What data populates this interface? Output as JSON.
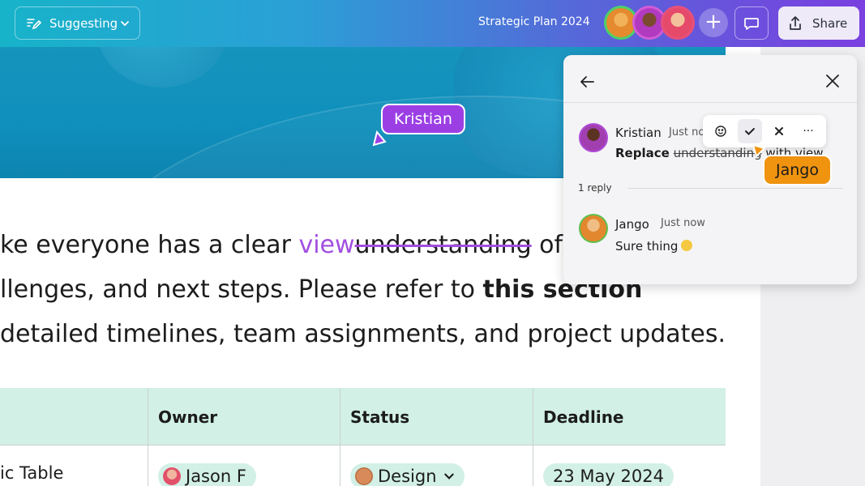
{
  "header": {
    "mode_label": "Suggesting",
    "doc_title": "Strategic Plan 2024",
    "share_label": "Share",
    "add_user_glyph": "+"
  },
  "canvas": {
    "cursor_label": "Kristian",
    "paragraph": {
      "line1_start": "ke everyone has a clear ",
      "line1_inserted": "view",
      "line1_deleted": "understanding",
      "line1_end": " of th",
      "line2_start": "llenges, and next steps. Please refer to ",
      "line2_bold": "this section",
      "line3": "detailed timelines, team assignments, and project updates."
    },
    "table": {
      "headers": [
        "",
        "Owner",
        "Status",
        "Deadline"
      ],
      "row1": {
        "c1": "ic Table",
        "owner": "Jason F",
        "status": "Design",
        "deadline": "23 May 2024"
      }
    }
  },
  "comments": {
    "thread": {
      "author": "Kristian",
      "time": "Just no",
      "action_word": "Replace",
      "deleted": "understanding",
      "rest": " with view"
    },
    "reply_count": "1 reply",
    "reply": {
      "author": "Jango",
      "time": "Just now",
      "text": "Sure thing"
    },
    "cursor_label": "Jango",
    "toolbar_more": "···"
  },
  "colors": {
    "accent_purple": "#9b3fe4",
    "accent_orange": "#f0930f",
    "table_header_bg": "#d2f0e6",
    "hero_bg": "#1595bd"
  }
}
